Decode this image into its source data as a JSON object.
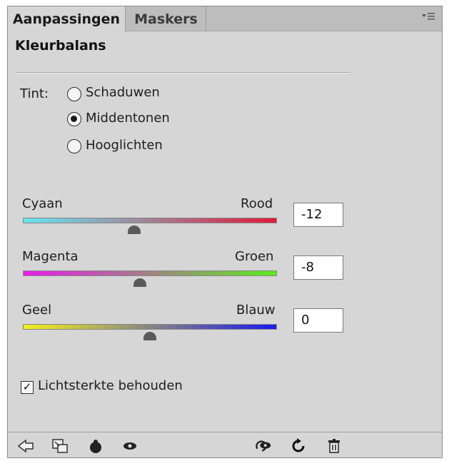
{
  "tabs": [
    {
      "label": "Aanpassingen",
      "active": true
    },
    {
      "label": "Maskers",
      "active": false
    }
  ],
  "panel_menu_icon": "panel-menu-icon",
  "title": "Kleurbalans",
  "tint": {
    "label": "Tint:",
    "options": [
      "Schaduwen",
      "Middentonen",
      "Hooglichten"
    ],
    "selected": "Middentonen"
  },
  "sliders": [
    {
      "left_label": "Cyaan",
      "right_label": "Rood",
      "value": "-12",
      "gradient": [
        "#66e6f2",
        "#e01a3a"
      ]
    },
    {
      "left_label": "Magenta",
      "right_label": "Groen",
      "value": "-8",
      "gradient": [
        "#e81aec",
        "#5aec1a"
      ]
    },
    {
      "left_label": "Geel",
      "right_label": "Blauw",
      "value": "0",
      "gradient": [
        "#f4f01a",
        "#1a1aec"
      ]
    }
  ],
  "preserve_luminosity": {
    "label": "Lichtsterkte behouden",
    "checked": true
  },
  "footer_icons": [
    "back-arrow-icon",
    "clip-layer-icon",
    "mask-icon",
    "visibility-eye-icon",
    "reset-view-icon",
    "reset-icon",
    "trash-icon"
  ]
}
